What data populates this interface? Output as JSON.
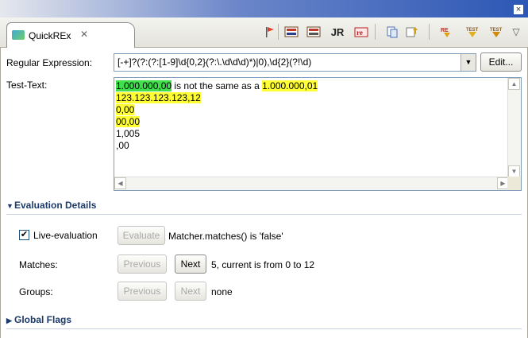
{
  "window": {
    "close_glyph": "×"
  },
  "tab": {
    "label": "QuickREx",
    "close_glyph": "✕",
    "icon": "quickrex-icon"
  },
  "toolbar": {
    "jr_label": "JR",
    "items": [
      "flag-icon",
      "regex-lib-icon",
      "regex-lib2-icon",
      "jr-icon",
      "re-icon",
      "copy-icon",
      "export-icon",
      "regex-icon",
      "test-icon",
      "test2-icon",
      "view-menu-icon"
    ],
    "menu_glyph": "▽"
  },
  "regex": {
    "label": "Regular Expression:",
    "value": "[-+]?(?:(?:[1-9]\\d{0,2}(?:\\.\\d\\d\\d)*)|0),\\d{2}(?!\\d)",
    "edit_label": "Edit...",
    "dropdown_glyph": "▼"
  },
  "test_text": {
    "label": "Test-Text:",
    "line1_match1": "1.000.000,00",
    "line1_mid": " is not the same as a ",
    "line1_match2": "1.000.000,01",
    "line2": "123.123.123.123,12",
    "line3": "0,00",
    "line4": "00,00",
    "line5": "1,005",
    "line6": ",00"
  },
  "evaluation": {
    "header": "Evaluation Details",
    "live_label": "Live-evaluation",
    "live_checked_glyph": "✔",
    "evaluate_label": "Evaluate",
    "status": "Matcher.matches() is 'false'",
    "matches_label": "Matches:",
    "previous_label": "Previous",
    "next_label": "Next",
    "matches_info": "5, current is from 0 to 12",
    "groups_label": "Groups:",
    "groups_previous": "Previous",
    "groups_next": "Next",
    "groups_info": "none"
  },
  "global_flags": {
    "header": "Global Flags"
  },
  "colors": {
    "match_current": "#3fe04b",
    "match_other": "#ffff33",
    "section_text": "#1c3a6b"
  }
}
